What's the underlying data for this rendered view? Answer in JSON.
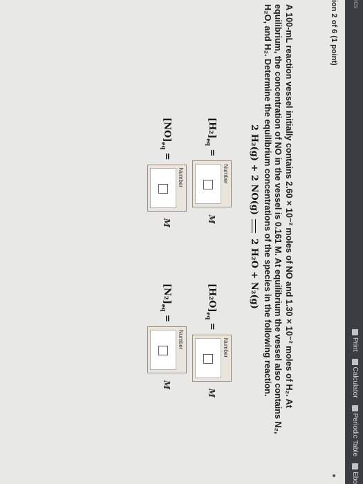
{
  "topbar": {
    "edge_text": "ics",
    "tools": [
      {
        "icon": "print-icon",
        "label": "Print"
      },
      {
        "icon": "calculator-icon",
        "label": "Calculator"
      },
      {
        "icon": "periodic-table-icon",
        "label": "Periodic Table"
      },
      {
        "icon": "ebook-icon",
        "label": "Ebo"
      }
    ]
  },
  "question": {
    "header": "ion 2 of 6 (1 point)",
    "problem_text": "A 100-mL reaction vessel initially contains 2.60 × 10⁻² moles of NO and 1.30 × 10⁻² moles of H₂. At equilibrium, the concentration of NO in the vessel is 0.161 M. At equilibrium the vessel also contains N₂, H₂O, and H₂. Determine the equilibrium concentrations of the species in the following reaction.",
    "reaction_left": "2 H₂(g) + 2 NO(g)",
    "reaction_right": "2 H₂O + N₂(g)"
  },
  "answers": [
    {
      "label_main": "[H₂]",
      "label_sub": "eq",
      "eq_sign": "=",
      "caption": "Number",
      "value": "",
      "unit": "M"
    },
    {
      "label_main": "[H₂O]",
      "label_sub": "eq",
      "eq_sign": "=",
      "caption": "Number",
      "value": "",
      "unit": "M"
    },
    {
      "label_main": "[NO]",
      "label_sub": "eq",
      "eq_sign": "=",
      "caption": "Number",
      "value": "",
      "unit": "M"
    },
    {
      "label_main": "[N₂]",
      "label_sub": "eq",
      "eq_sign": "=",
      "caption": "Number",
      "value": "",
      "unit": "M"
    }
  ]
}
